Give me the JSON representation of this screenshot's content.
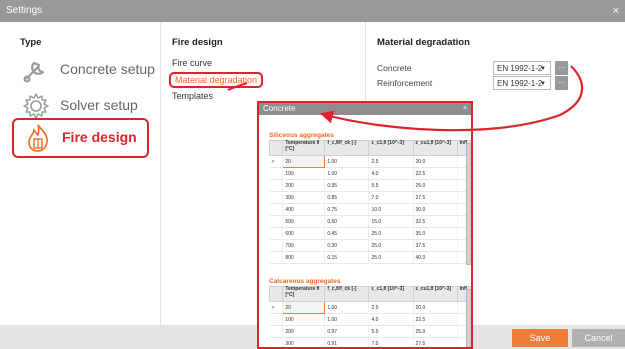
{
  "window": {
    "title": "Settings",
    "close_glyph": "×"
  },
  "type_column": {
    "header": "Type",
    "items": [
      {
        "label": "Concrete setup",
        "icon": "wrench-icon"
      },
      {
        "label": "Solver setup",
        "icon": "gear-icon"
      },
      {
        "label": "Fire design",
        "icon": "fire-icon"
      }
    ]
  },
  "fire_column": {
    "header": "Fire design",
    "items": [
      {
        "label": "Fire curve"
      },
      {
        "label": "Material degradation"
      },
      {
        "label": "Templates"
      }
    ]
  },
  "degradation_column": {
    "header": "Material degradation",
    "rows": [
      {
        "label": "Concrete",
        "value": "EN 1992-1-2",
        "button": "..."
      },
      {
        "label": "Reinforcement",
        "value": "EN 1992-1-2",
        "button": "..."
      }
    ]
  },
  "popup": {
    "title": "Concrete",
    "close_glyph": "×",
    "columns": [
      "Temperature θ [°C]",
      "f_c,θ/f_ck [-]",
      "ε_c1,θ [10^-3]",
      "ε_cu1,θ [10^-3]",
      "Infl"
    ],
    "siliceous": {
      "title": "Siliceous aggregates",
      "rows": [
        [
          "20",
          "1.00",
          "2.5",
          "20.0"
        ],
        [
          "100",
          "1.00",
          "4.0",
          "22.5"
        ],
        [
          "200",
          "0.95",
          "5.5",
          "25.0"
        ],
        [
          "300",
          "0.85",
          "7.0",
          "27.5"
        ],
        [
          "400",
          "0.75",
          "10.0",
          "30.0"
        ],
        [
          "500",
          "0.60",
          "15.0",
          "32.5"
        ],
        [
          "600",
          "0.45",
          "25.0",
          "35.0"
        ],
        [
          "700",
          "0.30",
          "25.0",
          "37.5"
        ],
        [
          "800",
          "0.15",
          "25.0",
          "40.0"
        ]
      ]
    },
    "calcareous": {
      "title": "Calcareous aggregates",
      "rows": [
        [
          "20",
          "1.00",
          "2.5",
          "20.0"
        ],
        [
          "100",
          "1.00",
          "4.0",
          "22.5"
        ],
        [
          "200",
          "0.97",
          "5.5",
          "25.0"
        ],
        [
          "300",
          "0.91",
          "7.0",
          "27.5"
        ]
      ]
    },
    "row_marker": ">"
  },
  "footer": {
    "save_label": "Save",
    "cancel_label": "Cancel"
  },
  "colors": {
    "accent": "#ee7d3a",
    "highlight": "#e0222b"
  }
}
